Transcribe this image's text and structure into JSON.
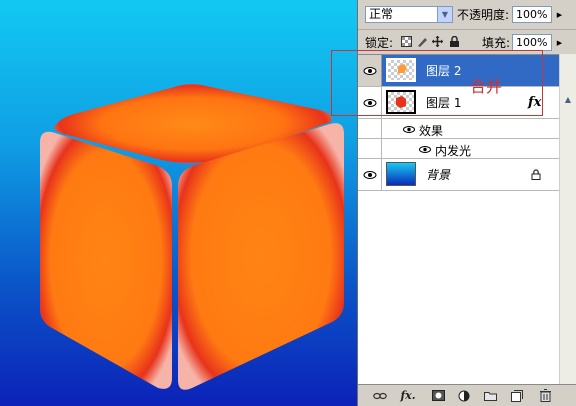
{
  "panel": {
    "blend_mode": "正常",
    "opacity_label": "不透明度:",
    "opacity_value": "100%",
    "lock_label": "锁定:",
    "fill_label": "填充:",
    "fill_value": "100%"
  },
  "layers": [
    {
      "name": "图层 2",
      "selected": true,
      "visible": true,
      "has_fx": false
    },
    {
      "name": "图层 1",
      "selected": false,
      "visible": true,
      "has_fx": true,
      "fx_label": "fx"
    },
    {
      "name": "背景",
      "selected": false,
      "visible": true,
      "locked": true
    }
  ],
  "effects": {
    "group_label": "效果",
    "item_label": "内发光"
  },
  "annotation": {
    "text": "合并",
    "color": "#d23030"
  },
  "bottom_bar": {
    "icons": [
      "link-icon",
      "fx-icon",
      "mask-icon",
      "adjustment-icon",
      "folder-icon",
      "new-layer-icon",
      "trash-icon"
    ],
    "fx_label": "fx."
  },
  "colors": {
    "selection": "#316ac5",
    "cube_orange": "#ff7a12",
    "cube_red": "#e8331b"
  }
}
